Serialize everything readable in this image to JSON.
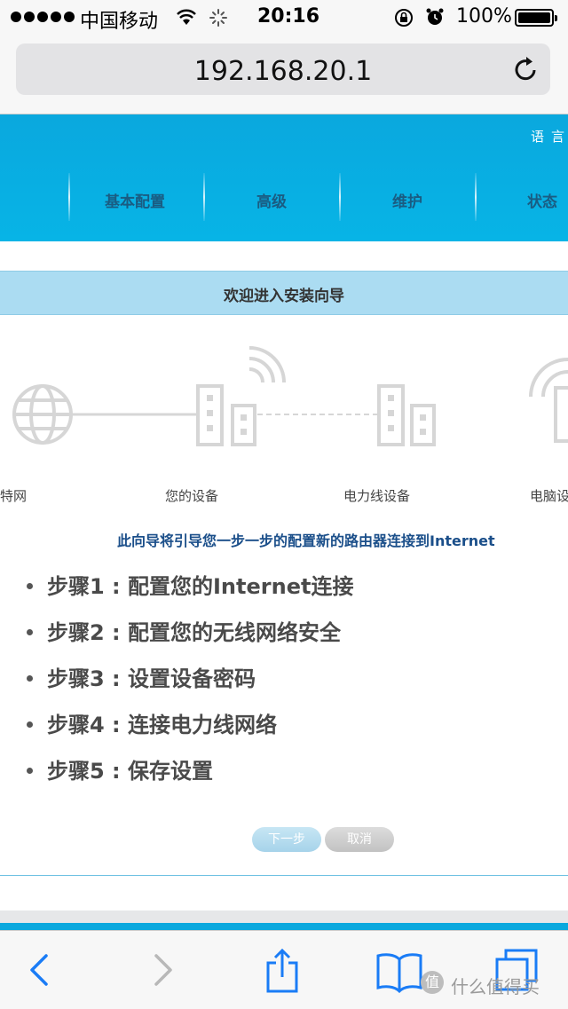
{
  "status_bar": {
    "carrier": "中国移动",
    "time": "20:16",
    "battery": "100%",
    "battery_level": 1.0,
    "icons": [
      "signal-dots-icon",
      "wifi-icon",
      "activity-spinner-icon",
      "orientation-lock-icon",
      "alarm-icon",
      "battery-icon"
    ]
  },
  "browser": {
    "url": "192.168.20.1",
    "reload_icon": "reload-icon"
  },
  "header": {
    "language": "语言",
    "nav": [
      "基本配置",
      "高级",
      "维护",
      "状态"
    ]
  },
  "wizard": {
    "title": "欢迎进入安装向导",
    "diagram_labels": [
      "特网",
      "您的设备",
      "电力线设备",
      "电脑设"
    ],
    "intro": "此向导将引导您一步一步的配置新的路由器连接到Internet",
    "steps": [
      "步骤1 : 配置您的Internet连接",
      "步骤2 : 配置您的无线网络安全",
      "步骤3 : 设置设备密码",
      "步骤4 : 连接电力线网络",
      "步骤5 : 保存设置"
    ],
    "next_label": "下一步",
    "cancel_label": "取消"
  },
  "toolbar": {
    "icons": [
      "back-icon",
      "forward-icon",
      "share-icon",
      "bookmarks-icon",
      "tabs-icon"
    ]
  },
  "watermark": {
    "logo": "值",
    "text": "什么值得买"
  },
  "colors": {
    "header_blue": "#0aa8de",
    "wizard_bar": "#abdcf2",
    "nav_text": "#1a5c82",
    "intro_text": "#1b4f8a",
    "ios_blue": "#1a7cf6"
  }
}
